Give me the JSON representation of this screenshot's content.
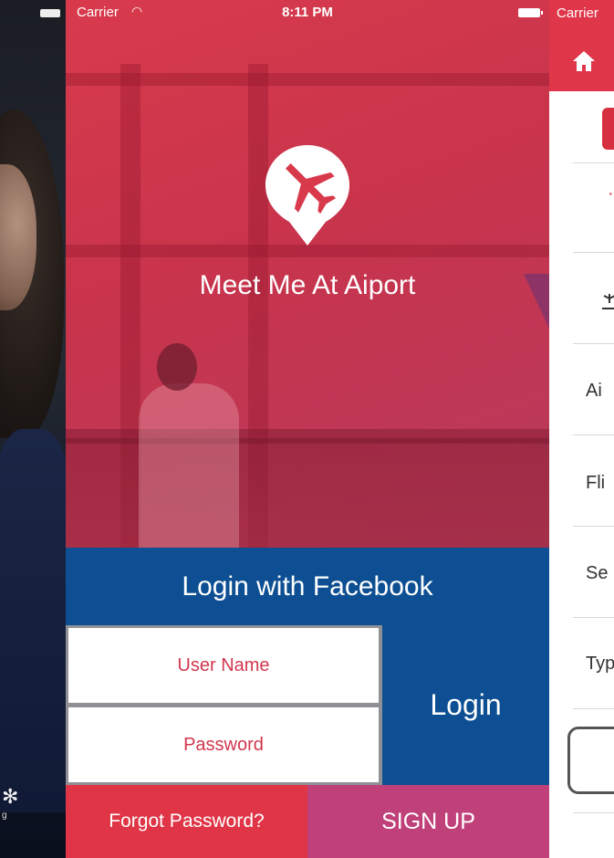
{
  "status_bar": {
    "carrier": "Carrier",
    "time": "8:11 PM"
  },
  "app": {
    "title": "Meet Me At Aiport"
  },
  "buttons": {
    "facebook": "Login with Facebook",
    "login": "Login",
    "forgot_password": "Forgot Password?",
    "sign_up": "SIGN UP"
  },
  "fields": {
    "username_placeholder": "User Name",
    "password_placeholder": "Password"
  },
  "left_panel": {
    "tab_label": "g"
  },
  "right_panel": {
    "carrier": "Carrier",
    "rows": [
      "Ai",
      "Fli",
      "Se",
      "Typ"
    ]
  },
  "colors": {
    "brand_red": "#e0364a",
    "facebook_blue": "#0d4f92",
    "signup_magenta": "#c0407a"
  },
  "icons": {
    "logo": "plane-pin-icon",
    "home": "home-icon",
    "wifi": "wifi-icon",
    "battery": "battery-icon"
  }
}
